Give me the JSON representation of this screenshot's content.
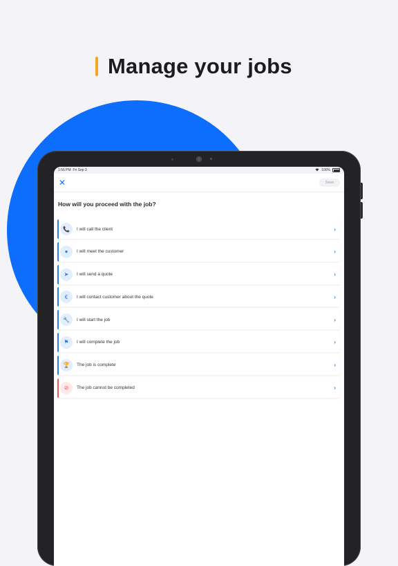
{
  "headline": {
    "title": "Manage your jobs",
    "accent": "#f5a623"
  },
  "background": {
    "circle_color": "#0d6efd"
  },
  "statusbar": {
    "time": "1:56 PM",
    "date": "Fri Sep 3",
    "battery": "100%"
  },
  "navbar": {
    "close_icon": "close-icon",
    "save_label": "Save"
  },
  "question": "How will you proceed with the job?",
  "options": [
    {
      "label": "I will call the client",
      "icon": "phone-icon",
      "glyph": "📞",
      "variant": "normal"
    },
    {
      "label": "I will meet the customer",
      "icon": "person-icon",
      "glyph": "●",
      "variant": "normal"
    },
    {
      "label": "I will send a quote",
      "icon": "send-icon",
      "glyph": "➤",
      "variant": "normal"
    },
    {
      "label": "I will contact customer about the quote",
      "icon": "euro-icon",
      "glyph": "€",
      "variant": "normal"
    },
    {
      "label": "I will start the job",
      "icon": "wrench-icon",
      "glyph": "🔧",
      "variant": "normal"
    },
    {
      "label": "I will complete the job",
      "icon": "flag-icon",
      "glyph": "⚑",
      "variant": "normal"
    },
    {
      "label": "The job is complete",
      "icon": "trophy-icon",
      "glyph": "🏆",
      "variant": "normal"
    },
    {
      "label": "The job cannot be completed",
      "icon": "block-icon",
      "glyph": "⊘",
      "variant": "danger"
    }
  ],
  "colors": {
    "primary": "#2a7de1",
    "danger": "#e85a5a"
  }
}
